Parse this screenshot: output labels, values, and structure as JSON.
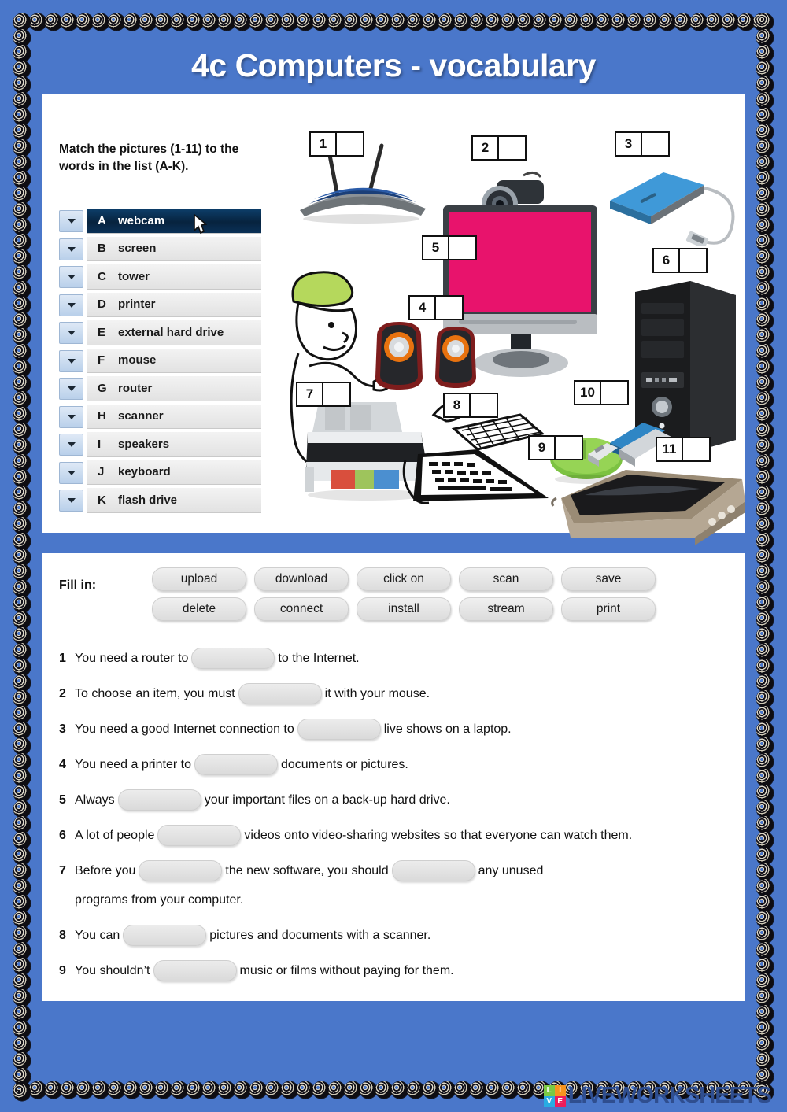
{
  "page": {
    "title": "4c Computers - vocabulary",
    "accent_blue": "#4a77ca",
    "sheet_bg": "#ffffff"
  },
  "match_section": {
    "instructions": "Match the pictures (1-11) to the words in the list (A-K).",
    "selected_letter": "A",
    "words": [
      {
        "letter": "A",
        "word": "webcam"
      },
      {
        "letter": "B",
        "word": "screen"
      },
      {
        "letter": "C",
        "word": "tower"
      },
      {
        "letter": "D",
        "word": "printer"
      },
      {
        "letter": "E",
        "word": "external hard drive"
      },
      {
        "letter": "F",
        "word": "mouse"
      },
      {
        "letter": "G",
        "word": "router"
      },
      {
        "letter": "H",
        "word": "scanner"
      },
      {
        "letter": "I",
        "word": "speakers"
      },
      {
        "letter": "J",
        "word": "keyboard"
      },
      {
        "letter": "K",
        "word": "flash drive"
      }
    ],
    "picture_boxes": [
      {
        "number": "1",
        "answer": "",
        "depicts": "router"
      },
      {
        "number": "2",
        "answer": "",
        "depicts": "webcam"
      },
      {
        "number": "3",
        "answer": "",
        "depicts": "external-hard-drive"
      },
      {
        "number": "4",
        "answer": "",
        "depicts": "speakers"
      },
      {
        "number": "5",
        "answer": "",
        "depicts": "screen"
      },
      {
        "number": "6",
        "answer": "",
        "depicts": "tower"
      },
      {
        "number": "7",
        "answer": "",
        "depicts": "printer"
      },
      {
        "number": "8",
        "answer": "",
        "depicts": "keyboard"
      },
      {
        "number": "9",
        "answer": "",
        "depicts": "mouse"
      },
      {
        "number": "10",
        "answer": "",
        "depicts": "flash-drive"
      },
      {
        "number": "11",
        "answer": "",
        "depicts": "scanner"
      }
    ]
  },
  "fill_section": {
    "label": "Fill in:",
    "word_bank_row1": [
      "upload",
      "download",
      "click on",
      "scan",
      "save"
    ],
    "word_bank_row2": [
      "delete",
      "connect",
      "install",
      "stream",
      "print"
    ],
    "sentences": [
      {
        "idx": "1",
        "before": "You need a router to",
        "after": "to the Internet.",
        "blanks": 1,
        "value": ""
      },
      {
        "idx": "2",
        "before": "To choose an item, you must",
        "after": "it with your mouse.",
        "blanks": 1,
        "value": ""
      },
      {
        "idx": "3",
        "before": "You need a good Internet connection to",
        "after": "live shows on a laptop.",
        "blanks": 1,
        "value": ""
      },
      {
        "idx": "4",
        "before": "You need a printer to",
        "after": "documents or pictures.",
        "blanks": 1,
        "value": ""
      },
      {
        "idx": "5",
        "before": "Always",
        "after": "your important files on a back-up hard drive.",
        "blanks": 1,
        "value": ""
      },
      {
        "idx": "6",
        "before": "A lot of people",
        "after": "videos onto video-sharing websites so that everyone can watch them.",
        "blanks": 1,
        "value": ""
      },
      {
        "idx": "7",
        "before": "Before you",
        "middle": "the new software, you should",
        "after": "any unused",
        "continuation": "programs from your computer.",
        "blanks": 2,
        "value": ""
      },
      {
        "idx": "8",
        "before": "You can",
        "after": "pictures and documents with a scanner.",
        "blanks": 1,
        "value": ""
      },
      {
        "idx": "9",
        "before": "You shouldn’t",
        "after": "music or films without paying for them.",
        "blanks": 1,
        "value": ""
      }
    ]
  },
  "footer": {
    "logo_tiles": [
      {
        "char": "L",
        "color": "#7ac943"
      },
      {
        "char": "I",
        "color": "#f7941e"
      },
      {
        "char": "V",
        "color": "#29abe2"
      },
      {
        "char": "E",
        "color": "#ed1c5b"
      }
    ],
    "logo_text": "LIVEWORKSHEETS"
  }
}
